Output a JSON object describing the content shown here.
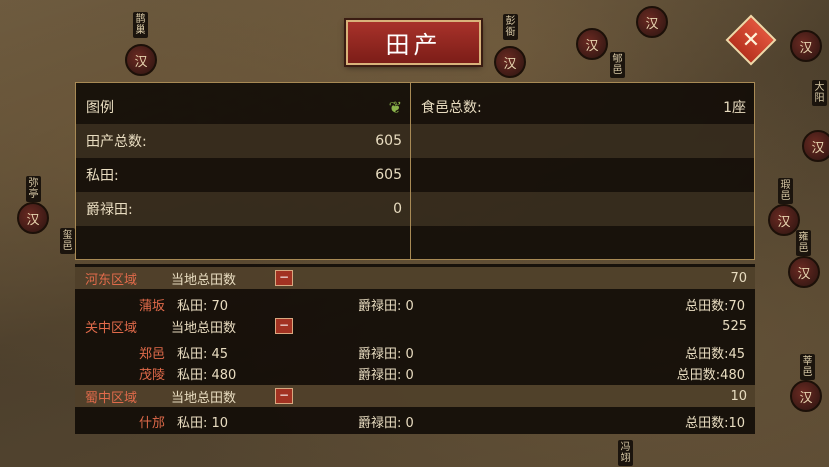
{
  "title": "田产",
  "close_glyph": "✕",
  "map": {
    "marker_glyph": "汉",
    "places": [
      "鹊巢",
      "彭衙",
      "大阳",
      "瑕邑",
      "雍邑",
      "弥亭",
      "玺邑",
      "莘邑",
      "郇邑",
      "冯翊"
    ]
  },
  "summary": {
    "legend_label": "图例",
    "legend_icon": "leaf-icon",
    "total_land_label": "田产总数:",
    "total_land_value": "605",
    "private_land_label": "私田:",
    "private_land_value": "605",
    "noble_land_label": "爵禄田:",
    "noble_land_value": "0",
    "fief_count_label": "食邑总数:",
    "fief_count_value": "1座"
  },
  "regions": [
    {
      "name": "河东区域",
      "label": "当地总田数",
      "collapse": "−",
      "total": "70",
      "cities": [
        {
          "name": "蒲坂",
          "private": "私田: 70",
          "jue": "爵禄田: 0",
          "total": "总田数:70"
        }
      ]
    },
    {
      "name": "关中区域",
      "label": "当地总田数",
      "collapse": "−",
      "total": "525",
      "cities": [
        {
          "name": "郑邑",
          "private": "私田: 45",
          "jue": "爵禄田: 0",
          "total": "总田数:45"
        },
        {
          "name": "茂陵",
          "private": "私田: 480",
          "jue": "爵禄田: 0",
          "total": "总田数:480"
        }
      ]
    },
    {
      "name": "蜀中区域",
      "label": "当地总田数",
      "collapse": "−",
      "total": "10",
      "cities": [
        {
          "name": "什邡",
          "private": "私田: 10",
          "jue": "爵禄田: 0",
          "total": "总田数:10"
        }
      ]
    }
  ],
  "colors": {
    "region_name": "#e06a4a",
    "title_red": "#a8322a",
    "panel_bg": "#120d08",
    "border_gold": "#a88a55"
  }
}
